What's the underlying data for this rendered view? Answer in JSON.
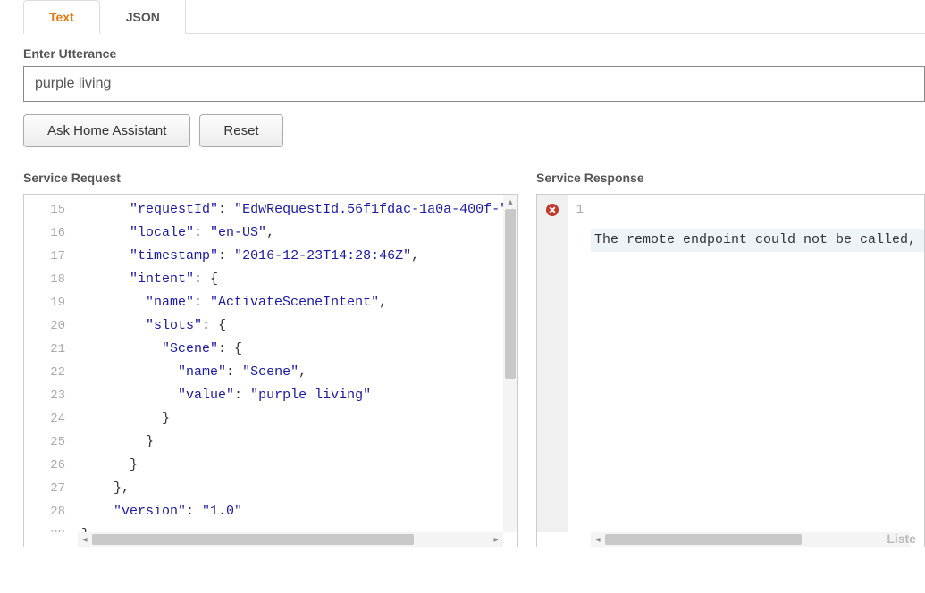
{
  "tabs": {
    "text": "Text",
    "json": "JSON"
  },
  "utterance": {
    "label": "Enter Utterance",
    "value": "purple living"
  },
  "buttons": {
    "ask": "Ask Home Assistant",
    "reset": "Reset"
  },
  "request": {
    "title": "Service Request",
    "line_start": 15,
    "lines": [
      {
        "indent": 3,
        "key": "requestId",
        "value": "EdwRequestId.56f1fdac-1a0a-400f-",
        "trail": ","
      },
      {
        "indent": 3,
        "key": "locale",
        "value": "en-US",
        "trail": ","
      },
      {
        "indent": 3,
        "key": "timestamp",
        "value": "2016-12-23T14:28:46Z",
        "trail": ","
      },
      {
        "indent": 3,
        "key": "intent",
        "open": "{"
      },
      {
        "indent": 4,
        "key": "name",
        "value": "ActivateSceneIntent",
        "trail": ","
      },
      {
        "indent": 4,
        "key": "slots",
        "open": "{"
      },
      {
        "indent": 5,
        "key": "Scene",
        "open": "{"
      },
      {
        "indent": 6,
        "key": "name",
        "value": "Scene",
        "trail": ","
      },
      {
        "indent": 6,
        "key": "value",
        "value": "purple living"
      },
      {
        "indent": 5,
        "close": "}"
      },
      {
        "indent": 4,
        "close": "}"
      },
      {
        "indent": 3,
        "close": "}"
      },
      {
        "indent": 2,
        "close": "},"
      },
      {
        "indent": 2,
        "key": "version",
        "value": "1.0"
      },
      {
        "indent": 0,
        "close": "}"
      }
    ]
  },
  "response": {
    "title": "Service Response",
    "line_start": 1,
    "text": "The remote endpoint could not be called,"
  },
  "footer": {
    "liste": "Liste"
  }
}
